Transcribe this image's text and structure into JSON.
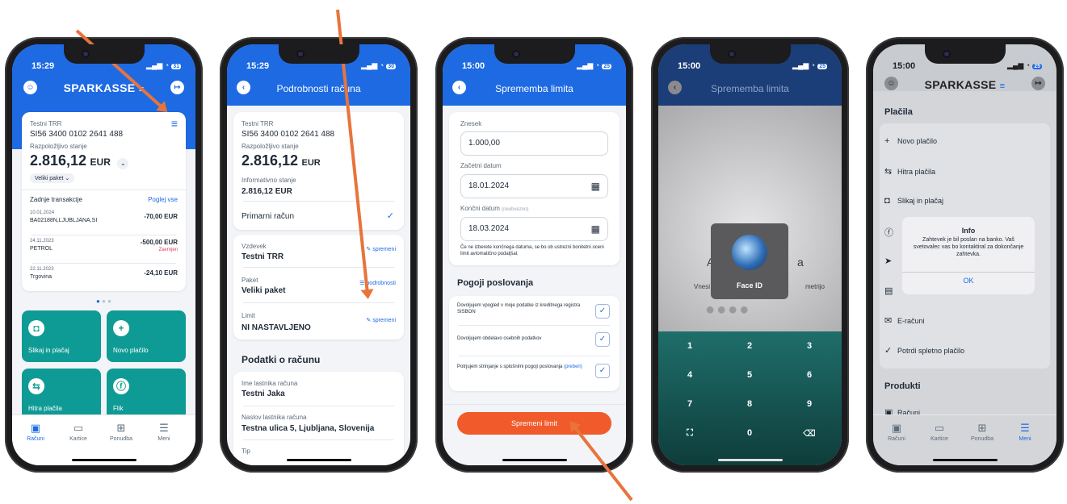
{
  "p1": {
    "time": "15:29",
    "battery": "31",
    "logo": "SPARKASSE",
    "account_name": "Testni TRR",
    "iban": "SI56 3400 0102 2641 488",
    "balance_label": "Razpoložljivo stanje",
    "balance": "2.816,12",
    "currency": "EUR",
    "package": "Veliki paket",
    "tx_title": "Zadnje transakcije",
    "tx_link": "Poglej vse",
    "tx": [
      {
        "date": "10.01.2024",
        "desc": "BA02188N,LJUBLJANA,SI",
        "amount": "-70,00 EUR",
        "status": ""
      },
      {
        "date": "24.11.2023",
        "desc": "PETROL",
        "amount": "-500,00 EUR",
        "status": "Zavrnjen"
      },
      {
        "date": "22.11.2023",
        "desc": "Trgovina",
        "amount": "-24,10 EUR",
        "status": ""
      }
    ],
    "tiles": [
      "Slikaj in plačaj",
      "Novo plačilo",
      "Hitra plačila",
      "Flik"
    ]
  },
  "tabs": [
    "Računi",
    "Kartice",
    "Ponudba",
    "Meni"
  ],
  "p2": {
    "time": "15:29",
    "battery": "30",
    "title": "Podrobnosti računa",
    "account_name": "Testni TRR",
    "iban": "SI56 3400 0102 2641 488",
    "balance_label": "Razpoložljivo stanje",
    "balance": "2.816,12",
    "currency": "EUR",
    "info_label": "Informativno stanje",
    "info_value": "2.816,12 EUR",
    "primary": "Primarni račun",
    "alias_label": "Vzdevek",
    "alias_value": "Testni TRR",
    "alias_link": "spremeni",
    "package_label": "Paket",
    "package_value": "Veliki paket",
    "package_link": "podrobnosti",
    "limit_label": "Limit",
    "limit_value": "NI NASTAVLJENO",
    "limit_link": "spremeni",
    "section": "Podatki o računu",
    "owner_label": "Ime lastnika računa",
    "owner_value": "Testni Jaka",
    "address_label": "Naslov lastnika računa",
    "address_value": "Testna ulica 5, Ljubljana, Slovenija",
    "type_label": "Tip"
  },
  "p3": {
    "time": "15:00",
    "battery": "25",
    "title": "Sprememba limita",
    "amount_label": "Znesek",
    "amount_value": "1.000,00",
    "start_label": "Začetni datum",
    "start_value": "18.01.2024",
    "end_label": "Končni datum",
    "end_optional": "(neobvezno)",
    "end_value": "18.03.2024",
    "note": "Če ne izberete končnega datuma, se bo ob ustrezni bonitetni oceni limit avtomatično podaljšal.",
    "terms_title": "Pogoji poslovanja",
    "terms": [
      "Dovoljujem vpogled v moje podatke iz kreditnega registra SISBON",
      "Dovoljujem obdelavo osebnih podatkov",
      "Potrjujem strinjanje s splošnimi pogoji poslovanja"
    ],
    "terms_link": "(preberi)",
    "button": "Spremeni limit"
  },
  "p4": {
    "time": "15:00",
    "battery": "25",
    "title": "Sprememba limita",
    "bg_left": "Vnesi",
    "bg_right": "metrijo",
    "bg_mid_a": "A",
    "bg_mid_b": "a",
    "faceid": "Face ID",
    "keys": [
      "1",
      "2",
      "3",
      "4",
      "5",
      "6",
      "7",
      "8",
      "9",
      "0"
    ]
  },
  "p5": {
    "time": "15:00",
    "battery": "25",
    "logo": "SPARKASSE",
    "section_payments": "Plačila",
    "items": [
      "Novo plačilo",
      "Hitra plačila",
      "Slikaj in plačaj",
      "E-računi",
      "Potrdi spletno plačilo"
    ],
    "section_products": "Produkti",
    "products_first": "Računi",
    "dialog_title": "Info",
    "dialog_text": "Zahtevek je bil poslan na banko. Vaš svetovalec vas bo kontaktiral za dokončanje zahtevka.",
    "dialog_ok": "OK"
  },
  "colors": {
    "primary": "#1d6ae3",
    "teal": "#0f9b95",
    "orange_button": "#f15a2b",
    "arrow": "#e8743b"
  }
}
